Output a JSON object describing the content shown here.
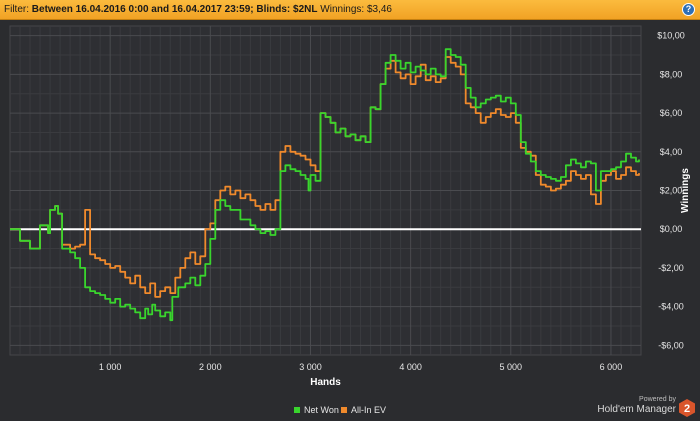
{
  "filter_bar": {
    "prefix": "Filter:",
    "range": "Between 16.04.2016 0:00 and 16.04.2017 23:59;",
    "blinds": "Blinds: $2NL",
    "winnings": "Winnings: $3,46",
    "help_label": "?"
  },
  "branding": {
    "powered_by": "Powered by",
    "product": "Hold'em Manager",
    "logo_number": "2"
  },
  "colors": {
    "background": "#2b2c2f",
    "filter_bar": "#f5a82b",
    "net_won": "#39d52d",
    "allin_ev": "#f08a2c",
    "zero_line": "#ffffff",
    "grid": "#4a4b4f"
  },
  "chart_data": {
    "type": "line",
    "xlabel": "Hands",
    "ylabel": "Winnings",
    "xlim": [
      0,
      6300
    ],
    "ylim": [
      -6.5,
      10.5
    ],
    "x_ticks": [
      1000,
      2000,
      3000,
      4000,
      5000,
      6000
    ],
    "x_tick_labels": [
      "1 000",
      "2 000",
      "3 000",
      "4 000",
      "5 000",
      "6 000"
    ],
    "y_ticks": [
      -6,
      -4,
      -2,
      0,
      2,
      4,
      6,
      8,
      10
    ],
    "y_tick_labels": [
      "-$6,00",
      "-$4,00",
      "-$2,00",
      "$0,00",
      "$2,00",
      "$4,00",
      "$6,00",
      "$8,00",
      "$10,00"
    ],
    "grid": true,
    "legend_position": "bottom-center",
    "series": [
      {
        "name": "Net Won",
        "color": "#39d52d",
        "points": [
          [
            0,
            0
          ],
          [
            100,
            -0.6
          ],
          [
            200,
            -1.0
          ],
          [
            300,
            0.2
          ],
          [
            380,
            -0.2
          ],
          [
            400,
            1.0
          ],
          [
            450,
            1.2
          ],
          [
            480,
            0.8
          ],
          [
            520,
            -1.0
          ],
          [
            600,
            -1.2
          ],
          [
            650,
            -1.5
          ],
          [
            700,
            -2.0
          ],
          [
            750,
            -3.0
          ],
          [
            800,
            -3.2
          ],
          [
            850,
            -3.3
          ],
          [
            900,
            -3.4
          ],
          [
            950,
            -3.6
          ],
          [
            1000,
            -3.8
          ],
          [
            1050,
            -3.6
          ],
          [
            1100,
            -4.0
          ],
          [
            1150,
            -3.9
          ],
          [
            1200,
            -4.1
          ],
          [
            1250,
            -4.3
          ],
          [
            1300,
            -4.6
          ],
          [
            1350,
            -4.1
          ],
          [
            1380,
            -4.4
          ],
          [
            1420,
            -3.9
          ],
          [
            1450,
            -4.2
          ],
          [
            1500,
            -4.5
          ],
          [
            1550,
            -4.3
          ],
          [
            1600,
            -4.7
          ],
          [
            1620,
            -3.5
          ],
          [
            1680,
            -3.0
          ],
          [
            1750,
            -2.8
          ],
          [
            1800,
            -2.5
          ],
          [
            1850,
            -2.9
          ],
          [
            1900,
            -2.4
          ],
          [
            1950,
            -1.8
          ],
          [
            2000,
            -0.5
          ],
          [
            2050,
            1.0
          ],
          [
            2100,
            1.5
          ],
          [
            2150,
            1.2
          ],
          [
            2200,
            1.0
          ],
          [
            2300,
            0.5
          ],
          [
            2400,
            0.2
          ],
          [
            2450,
            0.0
          ],
          [
            2500,
            -0.2
          ],
          [
            2550,
            -0.1
          ],
          [
            2600,
            -0.3
          ],
          [
            2650,
            0.0
          ],
          [
            2700,
            3.0
          ],
          [
            2750,
            3.3
          ],
          [
            2800,
            3.1
          ],
          [
            2850,
            3.0
          ],
          [
            2900,
            2.8
          ],
          [
            2950,
            2.6
          ],
          [
            2980,
            2.0
          ],
          [
            3000,
            2.8
          ],
          [
            3050,
            2.5
          ],
          [
            3100,
            6.0
          ],
          [
            3150,
            5.8
          ],
          [
            3200,
            5.5
          ],
          [
            3250,
            5.0
          ],
          [
            3300,
            5.2
          ],
          [
            3350,
            4.8
          ],
          [
            3400,
            4.9
          ],
          [
            3450,
            4.6
          ],
          [
            3500,
            4.8
          ],
          [
            3550,
            4.5
          ],
          [
            3600,
            6.3
          ],
          [
            3650,
            6.2
          ],
          [
            3700,
            7.5
          ],
          [
            3750,
            8.6
          ],
          [
            3800,
            9.0
          ],
          [
            3850,
            8.7
          ],
          [
            3900,
            8.3
          ],
          [
            3950,
            8.6
          ],
          [
            4000,
            8.1
          ],
          [
            4050,
            8.4
          ],
          [
            4100,
            8.2
          ],
          [
            4150,
            8.0
          ],
          [
            4200,
            8.3
          ],
          [
            4250,
            8.0
          ],
          [
            4300,
            7.9
          ],
          [
            4350,
            9.3
          ],
          [
            4400,
            9.0
          ],
          [
            4450,
            8.9
          ],
          [
            4500,
            8.5
          ],
          [
            4550,
            7.3
          ],
          [
            4600,
            6.8
          ],
          [
            4650,
            6.3
          ],
          [
            4700,
            6.5
          ],
          [
            4750,
            6.7
          ],
          [
            4800,
            6.8
          ],
          [
            4850,
            6.9
          ],
          [
            4900,
            6.6
          ],
          [
            4950,
            6.8
          ],
          [
            5000,
            6.5
          ],
          [
            5050,
            5.9
          ],
          [
            5100,
            4.5
          ],
          [
            5150,
            3.9
          ],
          [
            5200,
            3.5
          ],
          [
            5250,
            3.0
          ],
          [
            5300,
            2.8
          ],
          [
            5350,
            2.7
          ],
          [
            5400,
            2.6
          ],
          [
            5450,
            2.5
          ],
          [
            5500,
            2.7
          ],
          [
            5550,
            3.3
          ],
          [
            5600,
            3.6
          ],
          [
            5650,
            3.4
          ],
          [
            5700,
            3.2
          ],
          [
            5750,
            3.5
          ],
          [
            5800,
            3.4
          ],
          [
            5850,
            2.0
          ],
          [
            5900,
            3.0
          ],
          [
            5950,
            3.0
          ],
          [
            6000,
            3.1
          ],
          [
            6050,
            3.2
          ],
          [
            6100,
            3.5
          ],
          [
            6150,
            3.9
          ],
          [
            6200,
            3.7
          ],
          [
            6250,
            3.5
          ],
          [
            6280,
            3.6
          ]
        ]
      },
      {
        "name": "All-In EV",
        "color": "#f08a2c",
        "points": [
          [
            0,
            0
          ],
          [
            100,
            -0.6
          ],
          [
            200,
            -1.0
          ],
          [
            300,
            0.2
          ],
          [
            380,
            -0.2
          ],
          [
            400,
            1.0
          ],
          [
            450,
            1.2
          ],
          [
            480,
            0.8
          ],
          [
            520,
            -0.8
          ],
          [
            600,
            -1.0
          ],
          [
            650,
            -0.9
          ],
          [
            700,
            -0.8
          ],
          [
            750,
            1.0
          ],
          [
            800,
            -1.3
          ],
          [
            850,
            -1.5
          ],
          [
            900,
            -1.6
          ],
          [
            950,
            -1.8
          ],
          [
            1000,
            -2.0
          ],
          [
            1050,
            -1.9
          ],
          [
            1100,
            -2.2
          ],
          [
            1150,
            -2.5
          ],
          [
            1200,
            -2.8
          ],
          [
            1250,
            -2.4
          ],
          [
            1300,
            -3.0
          ],
          [
            1350,
            -3.3
          ],
          [
            1400,
            -2.8
          ],
          [
            1450,
            -3.5
          ],
          [
            1500,
            -3.2
          ],
          [
            1550,
            -3.0
          ],
          [
            1600,
            -3.3
          ],
          [
            1650,
            -2.5
          ],
          [
            1700,
            -2.0
          ],
          [
            1750,
            -1.5
          ],
          [
            1800,
            -1.2
          ],
          [
            1850,
            -1.8
          ],
          [
            1900,
            -1.4
          ],
          [
            1950,
            0.0
          ],
          [
            2000,
            0.3
          ],
          [
            2050,
            1.5
          ],
          [
            2100,
            2.0
          ],
          [
            2150,
            2.2
          ],
          [
            2200,
            1.8
          ],
          [
            2250,
            2.0
          ],
          [
            2300,
            1.6
          ],
          [
            2350,
            1.8
          ],
          [
            2400,
            1.5
          ],
          [
            2450,
            1.2
          ],
          [
            2500,
            1.0
          ],
          [
            2550,
            1.3
          ],
          [
            2600,
            1.0
          ],
          [
            2650,
            1.5
          ],
          [
            2700,
            4.0
          ],
          [
            2750,
            4.3
          ],
          [
            2800,
            4.0
          ],
          [
            2850,
            3.9
          ],
          [
            2900,
            3.8
          ],
          [
            2950,
            3.6
          ],
          [
            3000,
            3.3
          ],
          [
            3050,
            3.0
          ],
          [
            3100,
            6.0
          ],
          [
            3150,
            5.8
          ],
          [
            3200,
            5.5
          ],
          [
            3250,
            5.0
          ],
          [
            3300,
            5.2
          ],
          [
            3350,
            4.8
          ],
          [
            3400,
            4.9
          ],
          [
            3450,
            4.6
          ],
          [
            3500,
            4.8
          ],
          [
            3550,
            4.5
          ],
          [
            3600,
            6.3
          ],
          [
            3650,
            6.2
          ],
          [
            3700,
            7.5
          ],
          [
            3750,
            8.3
          ],
          [
            3800,
            8.7
          ],
          [
            3850,
            8.1
          ],
          [
            3900,
            7.8
          ],
          [
            3950,
            8.0
          ],
          [
            4000,
            7.5
          ],
          [
            4050,
            7.9
          ],
          [
            4100,
            8.5
          ],
          [
            4150,
            7.7
          ],
          [
            4200,
            7.9
          ],
          [
            4250,
            7.6
          ],
          [
            4300,
            7.8
          ],
          [
            4350,
            8.9
          ],
          [
            4400,
            8.6
          ],
          [
            4450,
            8.4
          ],
          [
            4500,
            8.0
          ],
          [
            4550,
            6.5
          ],
          [
            4600,
            6.3
          ],
          [
            4650,
            6.0
          ],
          [
            4700,
            5.5
          ],
          [
            4750,
            5.8
          ],
          [
            4800,
            6.0
          ],
          [
            4850,
            6.2
          ],
          [
            4900,
            5.9
          ],
          [
            4950,
            5.8
          ],
          [
            5000,
            6.0
          ],
          [
            5050,
            5.5
          ],
          [
            5100,
            4.2
          ],
          [
            5150,
            4.0
          ],
          [
            5200,
            3.8
          ],
          [
            5250,
            2.8
          ],
          [
            5300,
            2.3
          ],
          [
            5350,
            2.2
          ],
          [
            5400,
            2.0
          ],
          [
            5450,
            2.1
          ],
          [
            5500,
            2.3
          ],
          [
            5550,
            2.5
          ],
          [
            5600,
            3.0
          ],
          [
            5650,
            2.8
          ],
          [
            5700,
            2.6
          ],
          [
            5750,
            2.8
          ],
          [
            5800,
            1.8
          ],
          [
            5850,
            1.3
          ],
          [
            5900,
            2.5
          ],
          [
            5950,
            2.8
          ],
          [
            6000,
            3.0
          ],
          [
            6050,
            2.6
          ],
          [
            6100,
            2.8
          ],
          [
            6150,
            3.2
          ],
          [
            6200,
            3.0
          ],
          [
            6250,
            2.8
          ],
          [
            6280,
            2.9
          ]
        ]
      }
    ]
  }
}
